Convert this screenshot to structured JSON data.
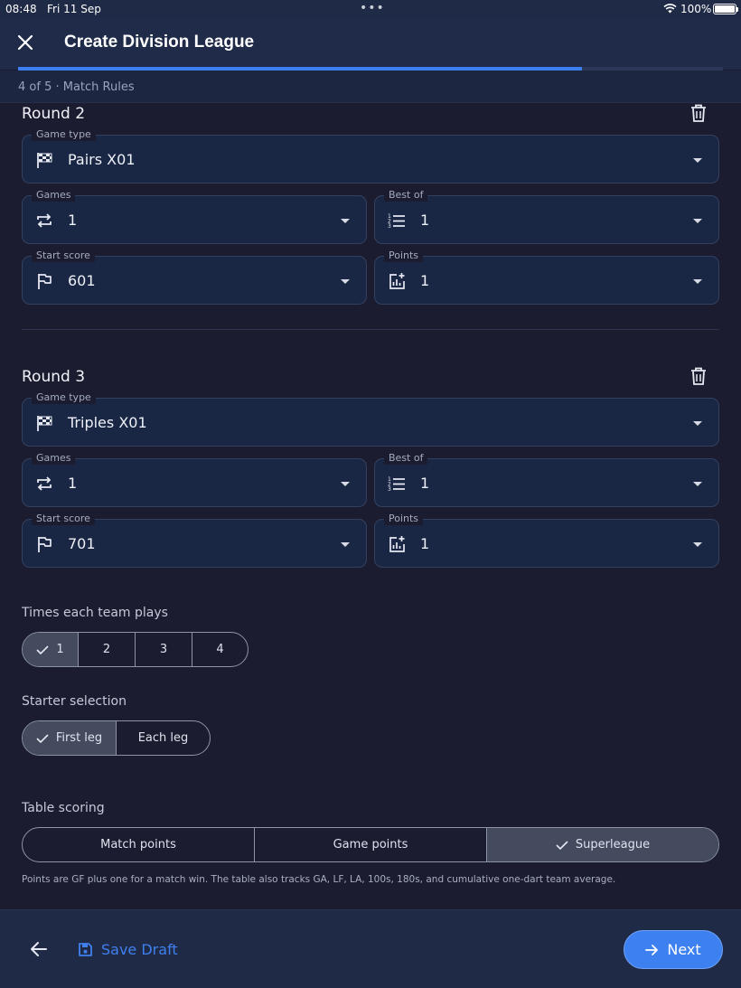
{
  "status_bar": {
    "time": "08:48",
    "date": "Fri 11 Sep",
    "battery": "100%"
  },
  "header": {
    "title": "Create Division League",
    "step": "4 of 5 · Match Rules",
    "progress": 0.8
  },
  "rounds": [
    {
      "title": "Round 2",
      "game_type": {
        "label": "Game type",
        "value": "Pairs X01"
      },
      "games": {
        "label": "Games",
        "value": "1"
      },
      "best_of": {
        "label": "Best of",
        "value": "1"
      },
      "start_score": {
        "label": "Start score",
        "value": "601"
      },
      "points": {
        "label": "Points",
        "value": "1"
      }
    },
    {
      "title": "Round 3",
      "game_type": {
        "label": "Game type",
        "value": "Triples X01"
      },
      "games": {
        "label": "Games",
        "value": "1"
      },
      "best_of": {
        "label": "Best of",
        "value": "1"
      },
      "start_score": {
        "label": "Start score",
        "value": "701"
      },
      "points": {
        "label": "Points",
        "value": "1"
      }
    }
  ],
  "times_each_team_plays": {
    "label": "Times each team plays",
    "options": [
      "1",
      "2",
      "3",
      "4"
    ],
    "selected": "1"
  },
  "starter_selection": {
    "label": "Starter selection",
    "options": [
      "First leg",
      "Each leg"
    ],
    "selected": "First leg"
  },
  "table_scoring": {
    "label": "Table scoring",
    "options": [
      "Match points",
      "Game points",
      "Superleague"
    ],
    "selected": "Superleague",
    "note": "Points are GF plus one for a match win. The table also tracks GA, LF, LA, 100s, 180s, and cumulative one-dart team average."
  },
  "footer": {
    "save_label": "Save Draft",
    "next_label": "Next"
  },
  "colors": {
    "accent": "#3d81f0",
    "background": "#1b1c2f",
    "field": "#1a2744",
    "selected_segment": "#444b5f"
  },
  "icons": [
    "close-icon",
    "trash-icon",
    "checkered-flag-icon",
    "repeat-icon",
    "numbered-list-icon",
    "flag-icon",
    "chart-plus-icon",
    "chevron-down-icon",
    "check-icon",
    "arrow-left-icon",
    "save-icon",
    "arrow-right-icon",
    "wifi-icon",
    "battery-icon"
  ]
}
